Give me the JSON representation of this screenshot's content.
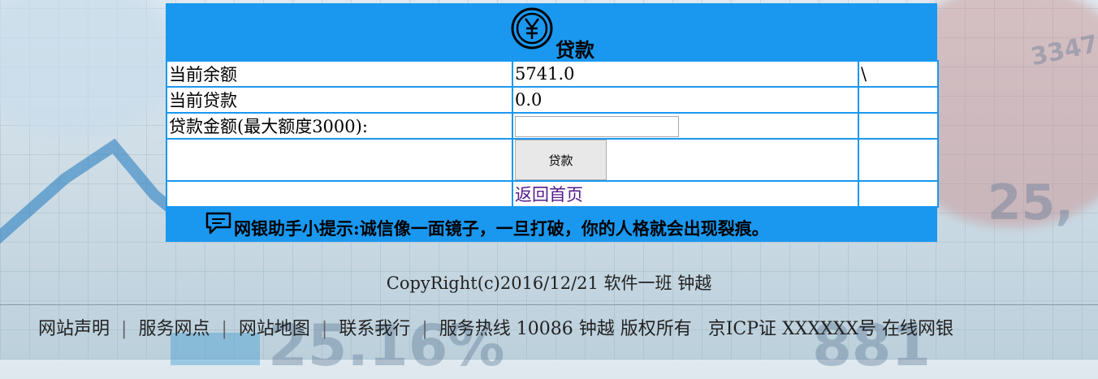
{
  "header": {
    "title": "贷款",
    "icon": "yuan-coin-icon"
  },
  "rows": [
    {
      "label": "当前余额",
      "value": "5741.0",
      "extra": "\\"
    },
    {
      "label": "当前贷款",
      "value": "0.0",
      "extra": ""
    },
    {
      "label": "贷款金额(最大额度3000):",
      "input_value": "",
      "extra": ""
    }
  ],
  "button": {
    "label": "贷款"
  },
  "back_link": "返回首页",
  "tip": {
    "icon": "speech-bubble-icon",
    "text": "网银助手小提示:诚信像一面镜子，一旦打破，你的人格就会出现裂痕。"
  },
  "copyright": "CopyRight(c)2016/12/21 软件一班 钟越",
  "footer": {
    "links": [
      "网站声明",
      "服务网点",
      "网站地图",
      "联系我行"
    ],
    "hotline": "服务热线 10086 钟越 版权所有",
    "icp": "京ICP证 XXXXXX号 在线网银"
  },
  "colors": {
    "panel": "#1a98f0",
    "link": "#551a8b"
  }
}
